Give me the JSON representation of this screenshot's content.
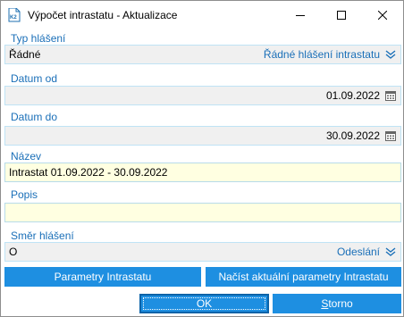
{
  "window": {
    "title": "Výpočet intrastatu - Aktualizace"
  },
  "fields": {
    "typ": {
      "label": "Typ hlášení",
      "value": "Řádné",
      "display": "Řádné hlášení intrastatu",
      "icon": "dropdown-icon"
    },
    "datum_od": {
      "label": "Datum od",
      "value": "01.09.2022",
      "icon": "calendar-icon"
    },
    "datum_do": {
      "label": "Datum do",
      "value": "30.09.2022",
      "icon": "calendar-icon"
    },
    "nazev": {
      "label": "Název",
      "value": "Intrastat 01.09.2022 - 30.09.2022"
    },
    "popis": {
      "label": "Popis",
      "value": ""
    },
    "smer": {
      "label": "Směr hlášení",
      "value": "O",
      "display": "Odeslání",
      "icon": "dropdown-icon"
    }
  },
  "buttons": {
    "parametry": "Parametry Intrastatu",
    "nacist": "Načíst aktuální parametry Intrastatu",
    "ok": "OK",
    "storno_first": "S",
    "storno_rest": "torno"
  },
  "colors": {
    "accent": "#1e8fe1",
    "label": "#1a6fb8",
    "editable_bg": "#ffffe1",
    "readonly_bg": "#f0f0f0"
  }
}
